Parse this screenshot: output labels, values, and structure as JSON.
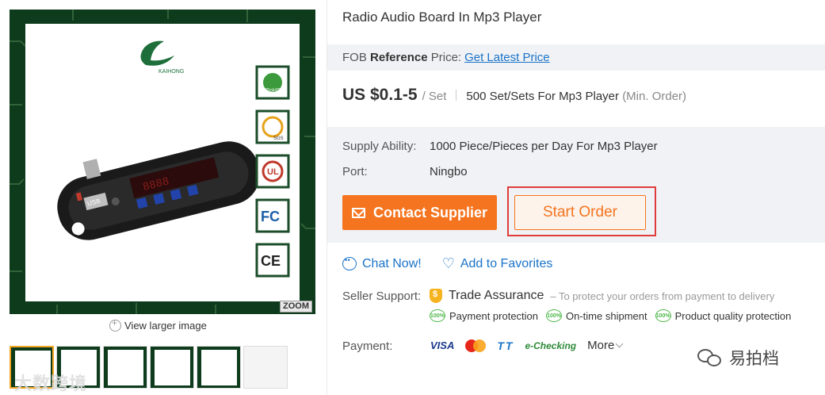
{
  "product": {
    "title": "Radio Audio Board In Mp3 Player"
  },
  "gallery": {
    "zoom_label": "ZOOM",
    "view_larger": "View larger image",
    "brand_logo_text": "KAIHONG",
    "thumb_count": 6,
    "watermark_left": "大数跨境"
  },
  "pricing": {
    "fob_label_prefix": "FOB ",
    "fob_label_bold": "Reference",
    "fob_label_suffix": " Price:",
    "fob_link": "Get Latest Price",
    "price": "US $0.1-5",
    "unit": "/ Set",
    "moq": "500 Set/Sets For Mp3 Player",
    "moq_note": "(Min. Order)"
  },
  "details": {
    "supply_label": "Supply Ability:",
    "supply_value": "1000 Piece/Pieces per Day For Mp3 Player",
    "port_label": "Port:",
    "port_value": "Ningbo"
  },
  "actions": {
    "contact": "Contact Supplier",
    "start_order": "Start Order",
    "chat": "Chat Now!",
    "favorites": "Add to Favorites"
  },
  "seller_support": {
    "label": "Seller Support:",
    "trade_assurance": "Trade Assurance",
    "ta_desc": "– To protect your orders from payment to delivery",
    "guarantees": [
      "Payment protection",
      "On-time shipment",
      "Product quality protection"
    ],
    "badge_text": "100%"
  },
  "payment": {
    "label": "Payment:",
    "methods": [
      "VISA",
      "TT",
      "e-Checking"
    ],
    "more": "More"
  },
  "watermark_right": "易拍档",
  "colors": {
    "accent_orange": "#f5741f",
    "link_blue": "#1a73c8",
    "pcb_green": "#0d3b1c",
    "highlight_red": "#e03c3c"
  }
}
